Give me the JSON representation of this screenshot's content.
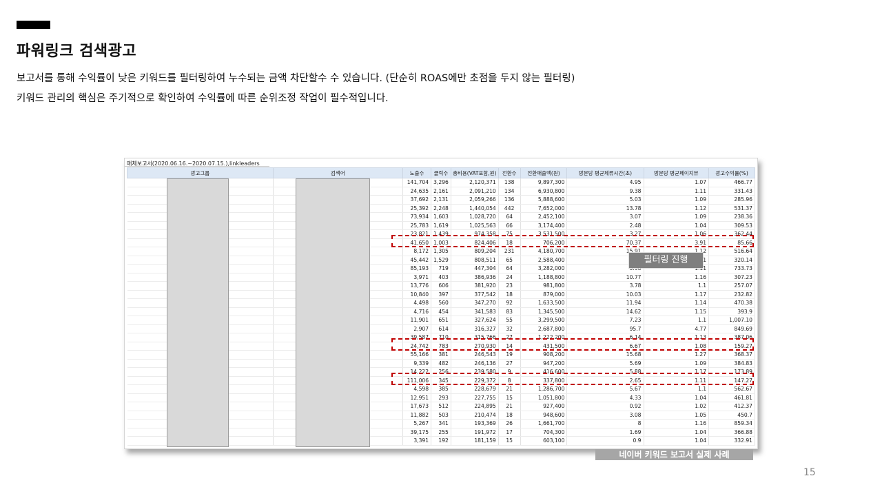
{
  "slide": {
    "title": "파워링크 검색광고",
    "description_line1": "보고서를 통해 수익률이 낮은 키워드를 필터링하여 누수되는 금액 차단할수 수 있습니다. (단순히 ROAS에만 초점을 두지 않는 필터링)",
    "description_line2": "키워드 관리의 핵심은 주기적으로 확인하여 수익률에 따른 순위조정 작업이 필수적입니다.",
    "page_number": "15",
    "filter_label": "필터링 진행",
    "caption": "네이버 키워드 보고서 실제 사례"
  },
  "report": {
    "title": "매체보고서(2020.06.16.~2020.07.15.),linkleaders",
    "columns": [
      "광고그룹",
      "검색어",
      "노출수",
      "클릭수",
      "총비용(VAT포함,원)",
      "전환수",
      "전환매출액(원)",
      "방문당 평균체류시간(초)",
      "방문당 평균페이지뷰",
      "광고수익률(%)"
    ],
    "rows": [
      [
        "141,704",
        "3,296",
        "2,120,371",
        "138",
        "9,897,300",
        "4.95",
        "1.07",
        "466.77"
      ],
      [
        "24,635",
        "2,161",
        "2,091,210",
        "134",
        "6,930,800",
        "9.38",
        "1.11",
        "331.43"
      ],
      [
        "37,692",
        "2,131",
        "2,059,266",
        "136",
        "5,888,600",
        "5.03",
        "1.09",
        "285.96"
      ],
      [
        "25,392",
        "2,248",
        "1,440,054",
        "442",
        "7,652,000",
        "13.78",
        "1.12",
        "531.37"
      ],
      [
        "73,934",
        "1,603",
        "1,028,720",
        "64",
        "2,452,100",
        "3.07",
        "1.09",
        "238.36"
      ],
      [
        "25,783",
        "1,619",
        "1,025,563",
        "66",
        "3,174,400",
        "2.48",
        "1.04",
        "309.53"
      ],
      [
        "23,821",
        "1,439",
        "974,358",
        "75",
        "3,531,500",
        "3.27",
        "1.06",
        "362.44"
      ],
      [
        "41,650",
        "1,003",
        "824,406",
        "18",
        "706,200",
        "70.37",
        "3.91",
        "85.66"
      ],
      [
        "8,172",
        "1,305",
        "809,204",
        "231",
        "4,180,700",
        "15.91",
        "1.12",
        "516.64"
      ],
      [
        "45,442",
        "1,529",
        "808,511",
        "65",
        "2,588,400",
        "5.98",
        "1.11",
        "320.14"
      ],
      [
        "85,193",
        "719",
        "447,304",
        "64",
        "3,282,000",
        "5.98",
        "1.11",
        "733.73"
      ],
      [
        "3,971",
        "403",
        "386,936",
        "24",
        "1,188,800",
        "10.77",
        "1.16",
        "307.23"
      ],
      [
        "13,776",
        "606",
        "381,920",
        "23",
        "981,800",
        "3.78",
        "1.1",
        "257.07"
      ],
      [
        "10,840",
        "397",
        "377,542",
        "18",
        "879,000",
        "10.03",
        "1.17",
        "232.82"
      ],
      [
        "4,498",
        "560",
        "347,270",
        "92",
        "1,633,500",
        "11.94",
        "1.14",
        "470.38"
      ],
      [
        "4,716",
        "454",
        "341,583",
        "83",
        "1,345,500",
        "14.62",
        "1.15",
        "393.9"
      ],
      [
        "11,901",
        "651",
        "327,624",
        "55",
        "3,299,500",
        "7.23",
        "1.1",
        "1,007.10"
      ],
      [
        "2,907",
        "614",
        "316,327",
        "32",
        "2,687,800",
        "95.7",
        "4.77",
        "849.69"
      ],
      [
        "39,587",
        "710",
        "315,766",
        "27",
        "1,222,200",
        "6.14",
        "1.13",
        "387.06"
      ],
      [
        "24,742",
        "783",
        "270,930",
        "14",
        "431,500",
        "6.67",
        "1.08",
        "159.27"
      ],
      [
        "55,166",
        "381",
        "246,543",
        "19",
        "908,200",
        "15.68",
        "1.27",
        "368.37"
      ],
      [
        "9,339",
        "482",
        "246,136",
        "27",
        "947,200",
        "5.69",
        "1.09",
        "384.83"
      ],
      [
        "14,222",
        "256",
        "239,580",
        "9",
        "416,600",
        "5.88",
        "1.17",
        "173.89"
      ],
      [
        "111,006",
        "345",
        "229,372",
        "8",
        "337,800",
        "2.65",
        "1.11",
        "147.27"
      ],
      [
        "4,598",
        "385",
        "228,679",
        "21",
        "1,286,700",
        "5.67",
        "1.1",
        "562.67"
      ],
      [
        "12,951",
        "293",
        "227,755",
        "15",
        "1,051,800",
        "4.33",
        "1.04",
        "461.81"
      ],
      [
        "17,673",
        "512",
        "224,895",
        "21",
        "927,400",
        "0.92",
        "1.02",
        "412.37"
      ],
      [
        "11,882",
        "503",
        "210,474",
        "18",
        "948,600",
        "3.08",
        "1.05",
        "450.7"
      ],
      [
        "5,267",
        "341",
        "193,369",
        "26",
        "1,661,700",
        "8",
        "1.16",
        "859.34"
      ],
      [
        "39,175",
        "255",
        "191,972",
        "17",
        "704,300",
        "1.69",
        "1.04",
        "366.88"
      ],
      [
        "3,391",
        "192",
        "181,159",
        "15",
        "603,100",
        "0.9",
        "1.04",
        "332.91"
      ]
    ]
  },
  "colors": {
    "highlight": "#c00000",
    "header_bg": "#dde8f5",
    "mask": "#d9d9d9"
  }
}
